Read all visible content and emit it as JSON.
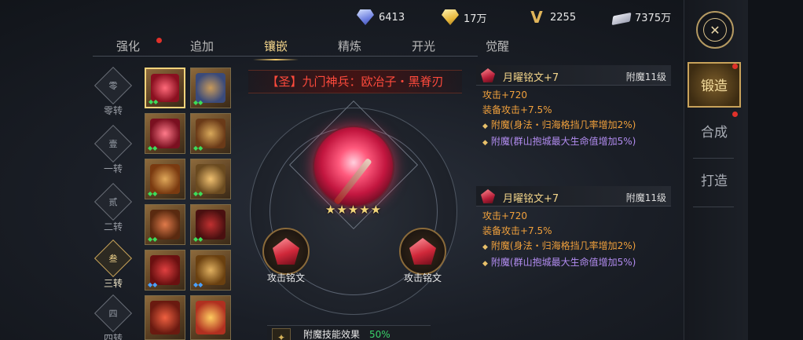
{
  "currency": [
    {
      "icon": "blue-diamond-icon",
      "value": "6413"
    },
    {
      "icon": "gold-diamond-icon",
      "value": "17万"
    },
    {
      "icon": "v-token-icon",
      "value": "2255"
    },
    {
      "icon": "silver-ingot-icon",
      "value": "7375万"
    }
  ],
  "tabs": [
    "强化",
    "追加",
    "镶嵌",
    "精炼",
    "开光",
    "觉醒"
  ],
  "active_tab": "镶嵌",
  "ranks": [
    {
      "badge": "零",
      "label": "零转"
    },
    {
      "badge": "壹",
      "label": "一转"
    },
    {
      "badge": "贰",
      "label": "二转"
    },
    {
      "badge": "叁",
      "label": "三转"
    },
    {
      "badge": "四",
      "label": "四转"
    }
  ],
  "active_rank": "三转",
  "item": {
    "title": "【圣】九门神兵：欧冶子・黑脊刃",
    "stars": "★★★★★",
    "sockets": [
      "攻击铭文",
      "攻击铭文"
    ]
  },
  "bottom_panel": {
    "label": "附魔技能效果",
    "value": "50%"
  },
  "inscriptions": [
    {
      "name": "月曜铭文+7",
      "level": "附魔11级",
      "attack": "攻击+720",
      "equip_attack": "装备攻击+7.5%",
      "enchant1": "附魔(身法・归海格挡几率增加2%)",
      "enchant2": "附魔(群山抱城最大生命值增加5%)"
    },
    {
      "name": "月曜铭文+7",
      "level": "附魔11级",
      "attack": "攻击+720",
      "equip_attack": "装备攻击+7.5%",
      "enchant1": "附魔(身法・归海格挡几率增加2%)",
      "enchant2": "附魔(群山抱城最大生命值增加5%)"
    }
  ],
  "sidebar": [
    "锻造",
    "合成",
    "打造"
  ],
  "colors": {
    "accent_gold": "#f1d38a",
    "title_red": "#ff4a3c",
    "enchant_purple": "#b28cf0",
    "stat_orange": "#f0a03c"
  }
}
